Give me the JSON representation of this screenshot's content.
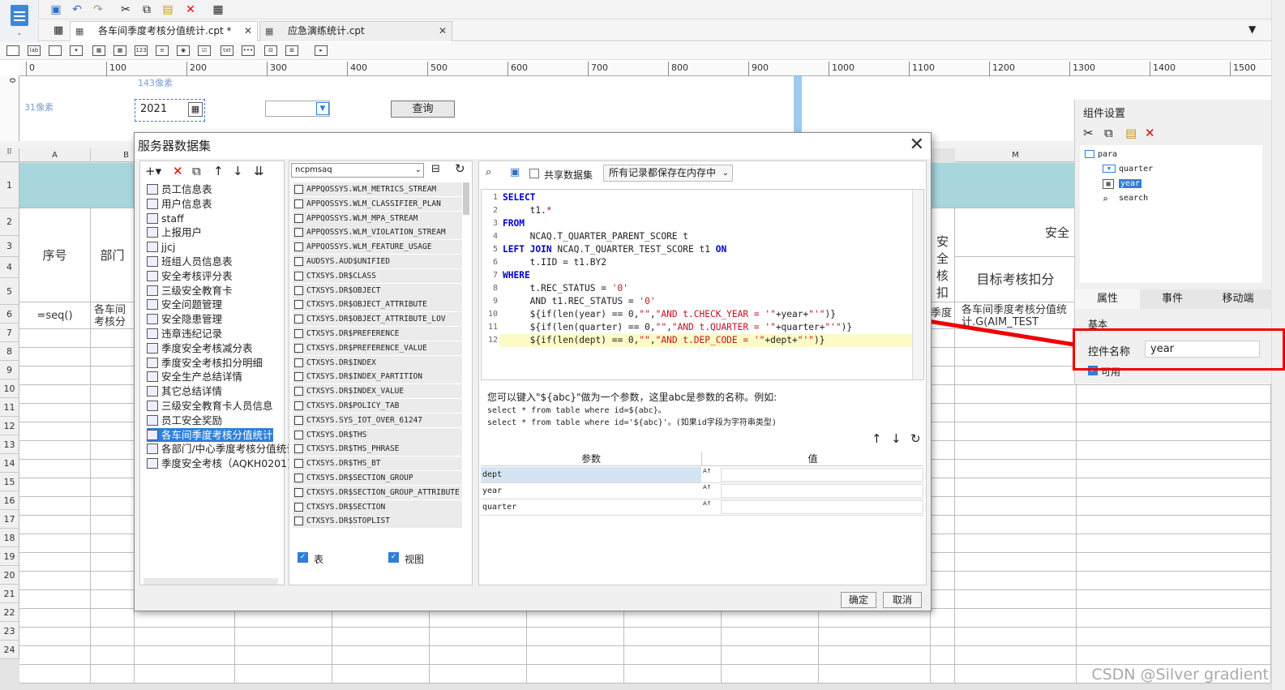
{
  "window": {
    "tabs": [
      {
        "label": "各车间季度考核分值统计.cpt *",
        "close": "✕"
      },
      {
        "label": "应急演练统计.cpt",
        "close": "✕"
      }
    ]
  },
  "ruler": {
    "ticks": [
      "0",
      "100",
      "200",
      "300",
      "400",
      "500",
      "600",
      "700",
      "800",
      "900",
      "1000",
      "1100",
      "1200",
      "1300",
      "1400",
      "1500"
    ]
  },
  "params_area": {
    "width_label": "143像素",
    "height_label": "31像素",
    "year_value": "2021",
    "query_button": "查询"
  },
  "grid": {
    "columns": [
      "A",
      "B",
      "M"
    ],
    "rows": [
      "1",
      "2",
      "3",
      "4",
      "5",
      "6",
      "7",
      "8",
      "9",
      "10",
      "11",
      "12",
      "13",
      "14",
      "15",
      "16",
      "17",
      "18",
      "19",
      "20",
      "21",
      "22",
      "23",
      "24"
    ],
    "cells": {
      "seq_header": "序号",
      "dept_header": "部门",
      "seq_formula": "=seq()",
      "b5": "各车间考核分",
      "safety_header": "安全",
      "safety_col": "安全核扣",
      "target_header": "目标考核扣分",
      "l5": "季度",
      "m5": "各车间季度考核分值统计.G(AIM_TEST"
    }
  },
  "dialog": {
    "title": "服务器数据集",
    "close": "✕",
    "datasets": [
      "员工信息表",
      "用户信息表",
      "staff",
      "上报用户",
      "jjcj",
      "班组人员信息表",
      "安全考核评分表",
      "三级安全教育卡",
      "安全问题管理",
      "安全隐患管理",
      "违章违纪记录",
      "季度安全考核减分表",
      "季度安全考核扣分明细",
      "安全生产总结详情",
      "其它总结详情",
      "三级安全教育卡人员信息",
      "员工安全奖励",
      "各车间季度考核分值统计",
      "各部门/中心季度考核分值统计",
      "季度安全考核（AQKH0201)"
    ],
    "selected_dataset": "各车间季度考核分值统计",
    "db_name": "ncpmsaq",
    "tables": [
      "APPQOSSYS.WLM_METRICS_STREAM",
      "APPQOSSYS.WLM_CLASSIFIER_PLAN",
      "APPQOSSYS.WLM_MPA_STREAM",
      "APPQOSSYS.WLM_VIOLATION_STREAM",
      "APPQOSSYS.WLM_FEATURE_USAGE",
      "AUDSYS.AUD$UNIFIED",
      "CTXSYS.DR$CLASS",
      "CTXSYS.DR$OBJECT",
      "CTXSYS.DR$OBJECT_ATTRIBUTE",
      "CTXSYS.DR$OBJECT_ATTRIBUTE_LOV",
      "CTXSYS.DR$PREFERENCE",
      "CTXSYS.DR$PREFERENCE_VALUE",
      "CTXSYS.DR$INDEX",
      "CTXSYS.DR$INDEX_PARTITION",
      "CTXSYS.DR$INDEX_VALUE",
      "CTXSYS.DR$POLICY_TAB",
      "CTXSYS.SYS_IOT_OVER_61247",
      "CTXSYS.DR$THS",
      "CTXSYS.DR$THS_PHRASE",
      "CTXSYS.DR$THS_BT",
      "CTXSYS.DR$SECTION_GROUP",
      "CTXSYS.DR$SECTION_GROUP_ATTRIBUTE",
      "CTXSYS.DR$SECTION",
      "CTXSYS.DR$STOPLIST"
    ],
    "table_checkbox": "表",
    "view_checkbox": "视图",
    "shared_label": "共享数据集",
    "memory_option": "所有记录都保存在内存中",
    "sql": [
      {
        "n": "1",
        "html": "<span class=\"kw\">SELECT</span>"
      },
      {
        "n": "2",
        "html": "     t1.<span class=\"str\">*</span>"
      },
      {
        "n": "3",
        "html": "<span class=\"kw\">FROM</span>"
      },
      {
        "n": "4",
        "html": "     NCAQ.T_QUARTER_PARENT_SCORE t"
      },
      {
        "n": "5",
        "html": "<span class=\"kw\">LEFT JOIN</span> NCAQ.T_QUARTER_TEST_SCORE t1 <span class=\"kw\">ON</span>"
      },
      {
        "n": "6",
        "html": "     t.IID = t1.BY2"
      },
      {
        "n": "7",
        "html": "<span class=\"kw\">WHERE</span>"
      },
      {
        "n": "8",
        "html": "     t.REC_STATUS = <span class=\"str\">'0'</span>"
      },
      {
        "n": "9",
        "html": "     AND t1.REC_STATUS = <span class=\"str\">'0'</span>"
      },
      {
        "n": "10",
        "html": "     ${if(len(year) == 0,<span class=\"str\">\"\"</span>,<span class=\"str\">\"AND t.CHECK_YEAR = '\"</span>+year+<span class=\"str\">\"'\"</span>)}"
      },
      {
        "n": "11",
        "html": "     ${if(len(quarter) == 0,<span class=\"str\">\"\"</span>,<span class=\"str\">\"AND t.QUARTER = '\"</span>+quarter+<span class=\"str\">\"'\"</span>)}"
      },
      {
        "n": "12",
        "html": "     ${if(len(dept) == 0,<span class=\"str\">\"\"</span>,<span class=\"str\">\"AND t.DEP_CODE = '\"</span>+dept+<span class=\"str\">\"'\"</span>)}"
      }
    ],
    "hint_line1": "您可以键入\"${abc}\"做为一个参数，这里abc是参数的名称。例如:",
    "hint_line2": "select * from table where id=${abc}。",
    "hint_line3": "select * from table where id='${abc}'。(如果id字段为字符串类型)",
    "param_header": "参数",
    "value_header": "值",
    "params": [
      "dept",
      "year",
      "quarter"
    ],
    "ok": "确定",
    "cancel": "取消"
  },
  "component_panel": {
    "title": "组件设置",
    "tree": [
      "para",
      "quarter",
      "year",
      "search"
    ],
    "selected": "year",
    "tabs": [
      "属性",
      "事件",
      "移动端"
    ],
    "section": "基本",
    "name_label": "控件名称",
    "name_value": "year",
    "enabled_label": "可用"
  },
  "watermark": "CSDN @Silver gradient"
}
